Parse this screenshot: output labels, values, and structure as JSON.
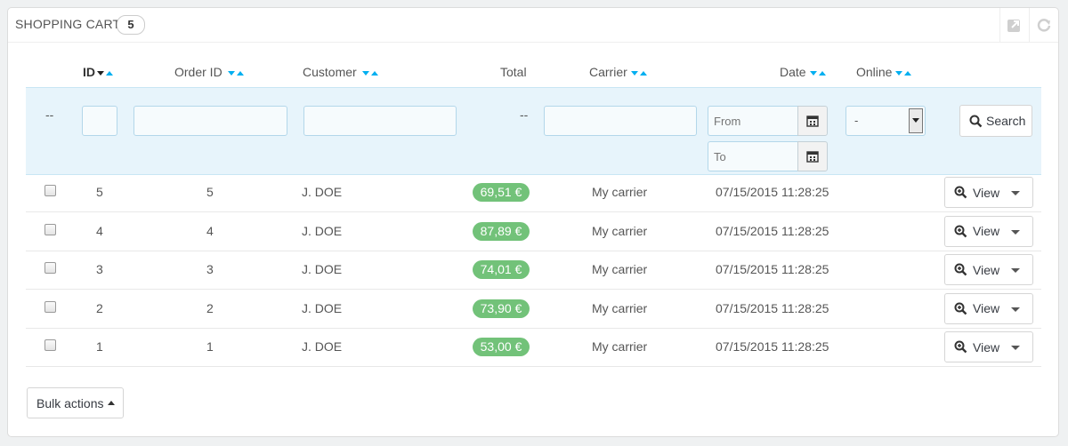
{
  "panel": {
    "title": "Shopping Carts",
    "count": "5",
    "tools": [
      "export-icon",
      "refresh-icon"
    ]
  },
  "columns": {
    "id": "ID",
    "order_id": "Order ID",
    "customer": "Customer",
    "total": "Total",
    "carrier": "Carrier",
    "date": "Date",
    "online": "Online"
  },
  "filters": {
    "checkbox_placeholder": "--",
    "total_placeholder": "--",
    "date_from_placeholder": "From",
    "date_to_placeholder": "To",
    "online_selected": "-",
    "search_label": "Search"
  },
  "rows": [
    {
      "id": "5",
      "order_id": "5",
      "customer": "J. DOE",
      "total": "69,51 €",
      "carrier": "My carrier",
      "date": "07/15/2015 11:28:25",
      "action": "View"
    },
    {
      "id": "4",
      "order_id": "4",
      "customer": "J. DOE",
      "total": "87,89 €",
      "carrier": "My carrier",
      "date": "07/15/2015 11:28:25",
      "action": "View"
    },
    {
      "id": "3",
      "order_id": "3",
      "customer": "J. DOE",
      "total": "74,01 €",
      "carrier": "My carrier",
      "date": "07/15/2015 11:28:25",
      "action": "View"
    },
    {
      "id": "2",
      "order_id": "2",
      "customer": "J. DOE",
      "total": "73,90 €",
      "carrier": "My carrier",
      "date": "07/15/2015 11:28:25",
      "action": "View"
    },
    {
      "id": "1",
      "order_id": "1",
      "customer": "J. DOE",
      "total": "53,00 €",
      "carrier": "My carrier",
      "date": "07/15/2015 11:28:25",
      "action": "View"
    }
  ],
  "footer": {
    "bulk_actions_label": "Bulk actions"
  },
  "colors": {
    "accent": "#00aff0",
    "price_badge": "#72c279",
    "filter_bg": "#e7f4fb"
  }
}
